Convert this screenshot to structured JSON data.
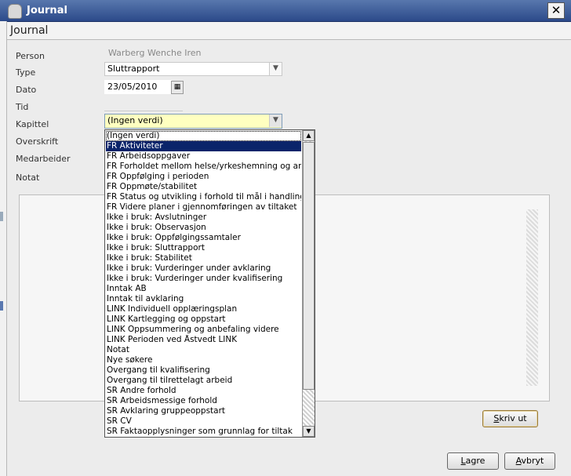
{
  "window": {
    "title": "Journal",
    "close_glyph": "✕"
  },
  "header": {
    "title": "Journal"
  },
  "form": {
    "person": {
      "label": "Person",
      "value": "Warberg Wenche Iren"
    },
    "type": {
      "label": "Type",
      "value": "Sluttrapport"
    },
    "dato": {
      "label": "Dato",
      "value": "23/05/2010"
    },
    "tid": {
      "label": "Tid"
    },
    "kapittel": {
      "label": "Kapittel",
      "value": "(Ingen verdi)"
    },
    "overskrift": {
      "label": "Overskrift"
    },
    "medarbeider": {
      "label": "Medarbeider"
    },
    "notat": {
      "label": "Notat"
    }
  },
  "dropdown": {
    "selected_index": 1,
    "options": [
      "(Ingen verdi)",
      "FR Aktiviteter",
      "FR Arbeidsoppgaver",
      "FR Forholdet mellom helse/yrkeshemning og arbeid",
      "FR Oppfølging i perioden",
      "FR Oppmøte/stabilitet",
      "FR Status og utvikling i forhold til mål i handlingsplan",
      "FR Videre planer i gjennomføringen av tiltaket",
      "Ikke i bruk: Avslutninger",
      "Ikke i bruk: Observasjon",
      "Ikke i bruk: Oppfølgingssamtaler",
      "Ikke i bruk: Sluttrapport",
      "Ikke i bruk: Stabilitet",
      "Ikke i bruk: Vurderinger under avklaring",
      "Ikke i bruk: Vurderinger under kvalifisering",
      "Inntak AB",
      "Inntak til avklaring",
      "LINK Individuell opplæringsplan",
      "LINK Kartlegging og oppstart",
      "LINK Oppsummering og anbefaling videre",
      "LINK Perioden ved Åstvedt LINK",
      "Notat",
      "Nye søkere",
      "Overgang til kvalifisering",
      "Overgang til tilrettelagt arbeid",
      "SR Andre forhold",
      "SR Arbeidsmessige forhold",
      "SR Avklaring gruppeoppstart",
      "SR CV",
      "SR Faktaopplysninger som grunnlag for tiltak"
    ]
  },
  "buttons": {
    "skriv_first": "S",
    "skriv_rest": "kriv ut",
    "lagre_first": "L",
    "lagre_rest": "agre",
    "avbryt_first": "A",
    "avbryt_rest": "vbryt"
  },
  "icons": {
    "dropdown": "chevron-down-icon",
    "calendar": "calendar-icon",
    "app": "journal-app-icon"
  }
}
